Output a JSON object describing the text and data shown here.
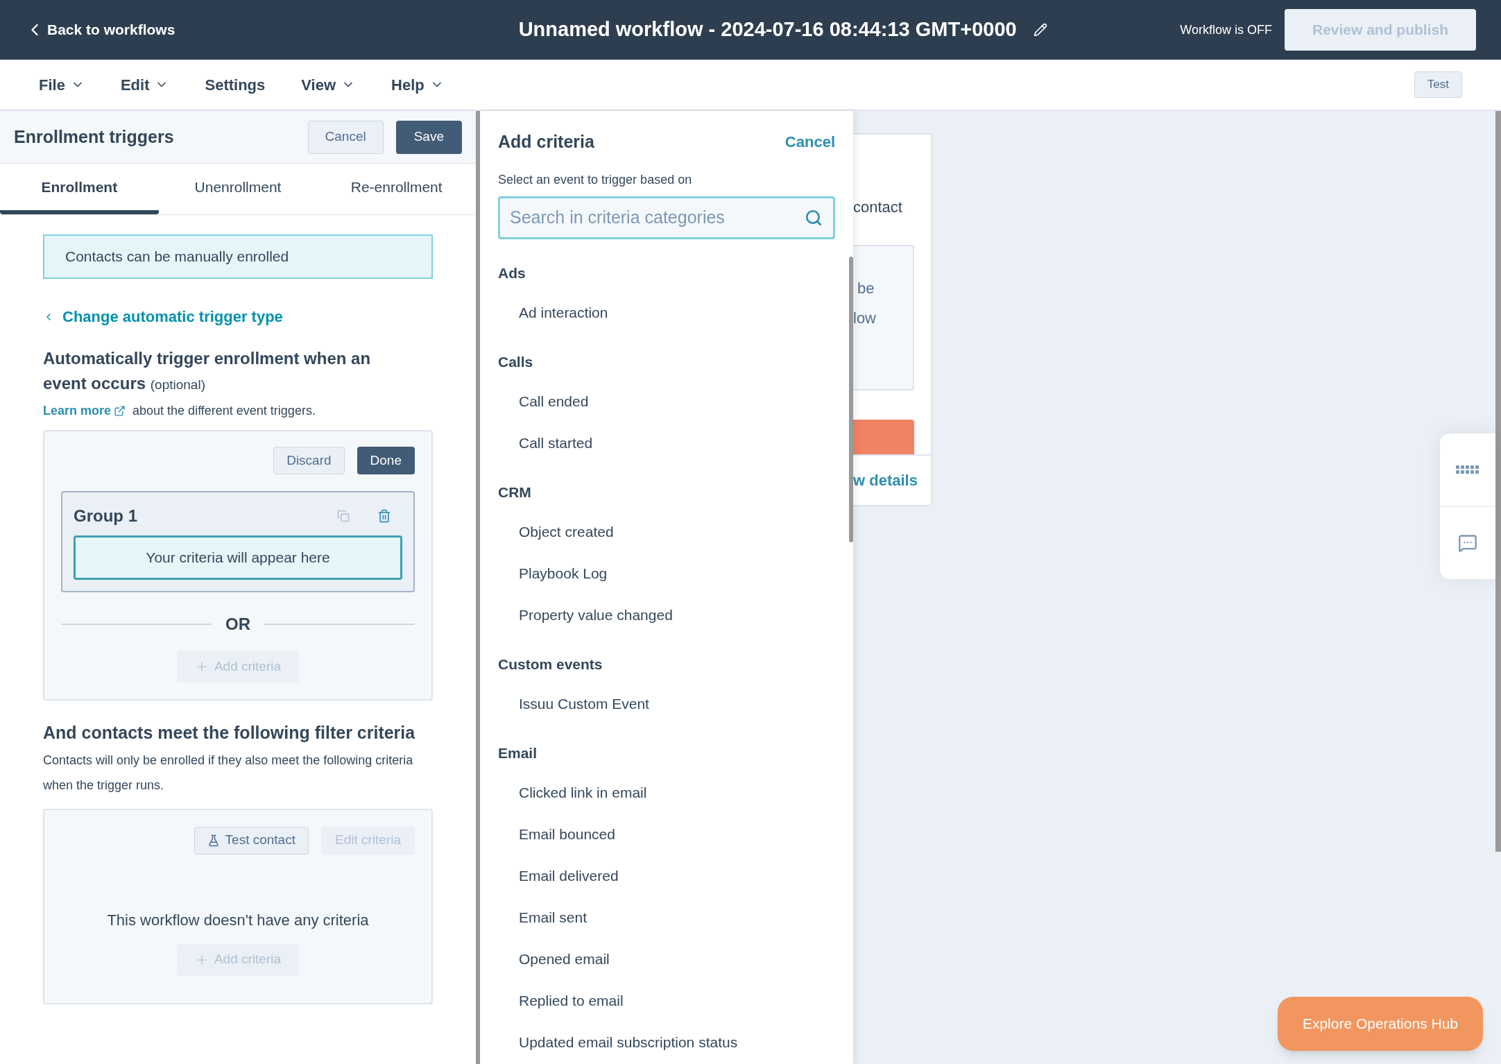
{
  "header": {
    "back_link": "Back to workflows",
    "title": "Unnamed workflow - 2024-07-16 08:44:13 GMT+0000",
    "status": "Workflow is OFF",
    "publish_button": {
      "label": "Review and publish",
      "disabled": true
    }
  },
  "menu": [
    {
      "label": "File",
      "dropdown": true
    },
    {
      "label": "Edit",
      "dropdown": true
    },
    {
      "label": "Settings",
      "dropdown": false
    },
    {
      "label": "View",
      "dropdown": true
    },
    {
      "label": "Help",
      "dropdown": true
    }
  ],
  "test_button": "Test",
  "triggers_panel": {
    "title": "Enrollment triggers",
    "cancel": "Cancel",
    "save": "Save",
    "tabs": [
      {
        "label": "Enrollment",
        "selected": true
      },
      {
        "label": "Unenrollment",
        "selected": false
      },
      {
        "label": "Re-enrollment",
        "selected": false
      }
    ],
    "manual_notice": "Contacts can be manually enrolled",
    "change_link": "Change automatic trigger type",
    "event_heading": "Automatically trigger enrollment when an event occurs",
    "event_heading_note": "(optional)",
    "learn_more": "Learn more",
    "learn_more_suffix": "about the different event triggers.",
    "event_box": {
      "discard": "Discard",
      "done": "Done",
      "group": {
        "title": "Group 1",
        "placeholder": "Your criteria will appear here"
      },
      "separator": "OR",
      "add_button": {
        "label": "Add criteria",
        "disabled": true
      }
    },
    "filter_heading": "And contacts meet the following filter criteria",
    "filter_description": "Contacts will only be enrolled if they also meet the following criteria when the trigger runs.",
    "filter_box": {
      "test_button": "Test contact",
      "edit_button": {
        "label": "Edit criteria",
        "disabled": true
      },
      "empty_message": "This workflow doesn't have any criteria",
      "add_button": {
        "label": "Add criteria",
        "disabled": true
      }
    }
  },
  "criteria_panel": {
    "title": "Add criteria",
    "cancel": "Cancel",
    "search_label": "Select an event to trigger based on",
    "search": {
      "placeholder": "Search in criteria categories"
    },
    "categories": [
      {
        "name": "Ads",
        "items": [
          "Ad interaction"
        ]
      },
      {
        "name": "Calls",
        "items": [
          "Call ended",
          "Call started"
        ]
      },
      {
        "name": "CRM",
        "items": [
          "Object created",
          "Playbook Log",
          "Property value changed"
        ]
      },
      {
        "name": "Custom events",
        "items": [
          "Issuu Custom Event"
        ]
      },
      {
        "name": "Email",
        "items": [
          "Clicked link in email",
          "Email bounced",
          "Email delivered",
          "Email sent",
          "Opened email",
          "Replied to email",
          "Updated email subscription status"
        ]
      }
    ]
  },
  "canvas_card": {
    "text_1": "contact",
    "text_2": "be",
    "text_3": "low",
    "link": "w details"
  },
  "promo_button": "Explore Operations Hub"
}
